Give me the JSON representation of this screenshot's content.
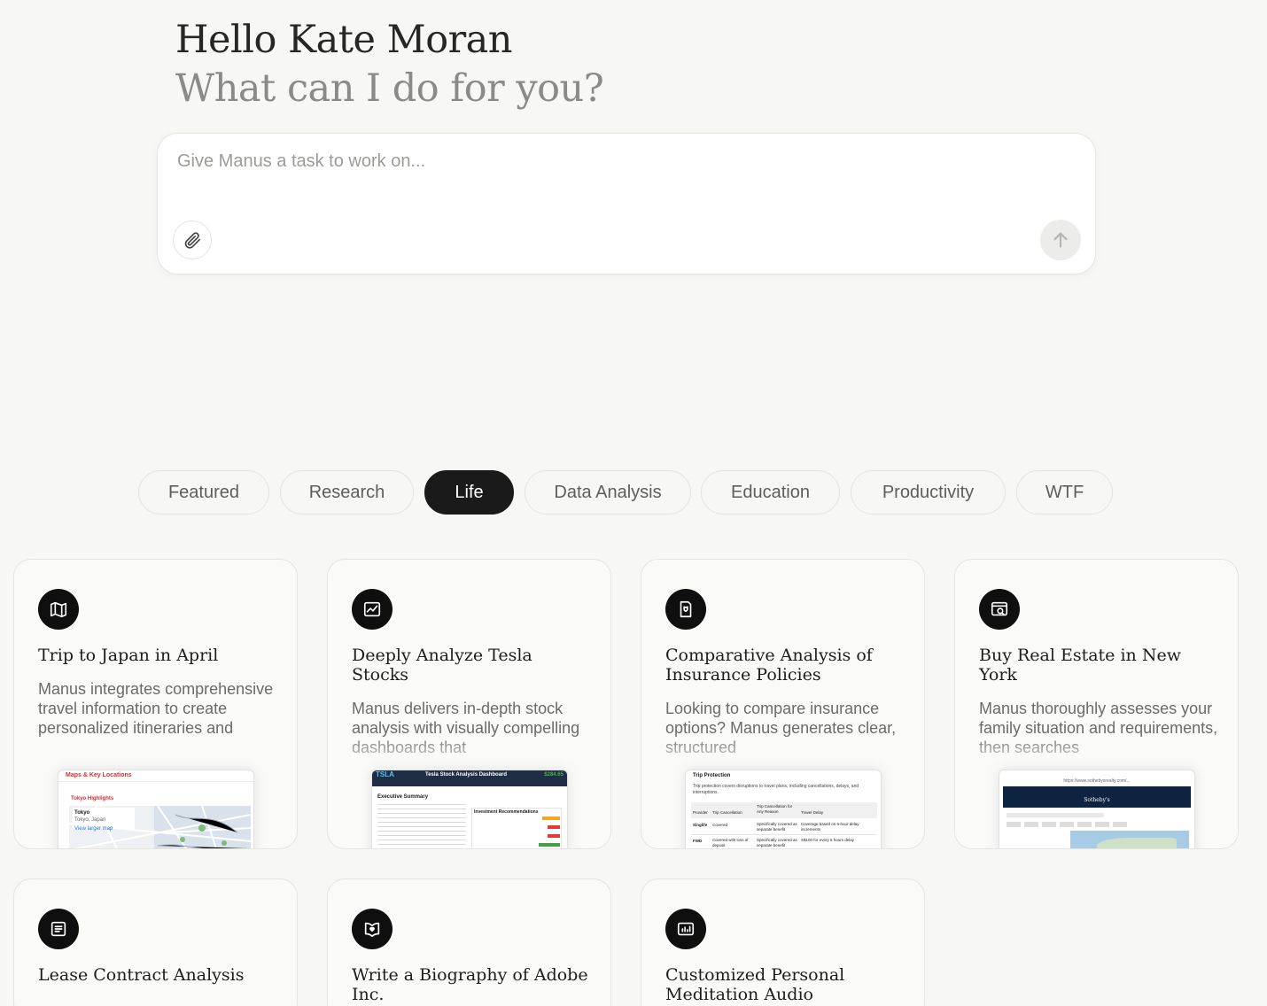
{
  "greeting": {
    "hello": "Hello Kate Moran",
    "prompt": "What can I do for you?"
  },
  "composer": {
    "placeholder": "Give Manus a task to work on...",
    "value": ""
  },
  "tabs": [
    {
      "label": "Featured",
      "active": false
    },
    {
      "label": "Research",
      "active": false
    },
    {
      "label": "Life",
      "active": true
    },
    {
      "label": "Data Analysis",
      "active": false
    },
    {
      "label": "Education",
      "active": false
    },
    {
      "label": "Productivity",
      "active": false
    },
    {
      "label": "WTF",
      "active": false
    }
  ],
  "cards": [
    {
      "icon": "map-icon",
      "title": "Trip to Japan in April",
      "description": "Manus integrates comprehensive travel information to create personalized itineraries and",
      "preview": {
        "heading": "Maps & Key Locations",
        "subheading": "Tokyo Highlights",
        "labels": [
          "Tokyo",
          "Tokyo, Japan",
          "View larger map"
        ]
      }
    },
    {
      "icon": "stock-chart-icon",
      "title": "Deeply Analyze Tesla Stocks",
      "description": "Manus delivers in-depth stock analysis with visually compelling dashboards that",
      "preview": {
        "ticker": "TSLA",
        "heading": "Tesla Stock Analysis Dashboard",
        "price": "$284.65",
        "section": "Executive Summary",
        "panel": "Investment Recommendations"
      }
    },
    {
      "icon": "shield-document-icon",
      "title": "Comparative Analysis of Insurance Policies",
      "description": "Looking to compare insurance options? Manus generates clear, structured",
      "preview": {
        "heading": "Trip Protection",
        "intro": "Trip protection covers disruptions to travel plans, including cancellations, delays, and interruptions.",
        "columns": [
          "Provider",
          "Trip Cancellation",
          "Trip Cancellation for Any Reason",
          "Travel Delay"
        ],
        "rows": [
          [
            "Singlife",
            "Covered",
            "Specifically covered as separate benefit",
            "Coverage based on 6-hour delay increments"
          ],
          [
            "FWD",
            "Covered with loss of deposit",
            "Specifically covered as separate benefit",
            "S$100 for every 6 hours delay"
          ]
        ]
      }
    },
    {
      "icon": "house-search-icon",
      "title": "Buy Real Estate in New York",
      "description": "Manus thoroughly assesses your family situation and requirements, then searches",
      "preview": {
        "url": "https://www.sothebysrealty.com/...",
        "brand": "Sotheby's"
      }
    },
    {
      "icon": "contract-list-icon",
      "title": "Lease Contract Analysis",
      "description": ""
    },
    {
      "icon": "book-heart-icon",
      "title": "Write a Biography of Adobe Inc.",
      "description": ""
    },
    {
      "icon": "audio-chart-icon",
      "title": "Customized Personal Meditation Audio",
      "description": ""
    }
  ]
}
